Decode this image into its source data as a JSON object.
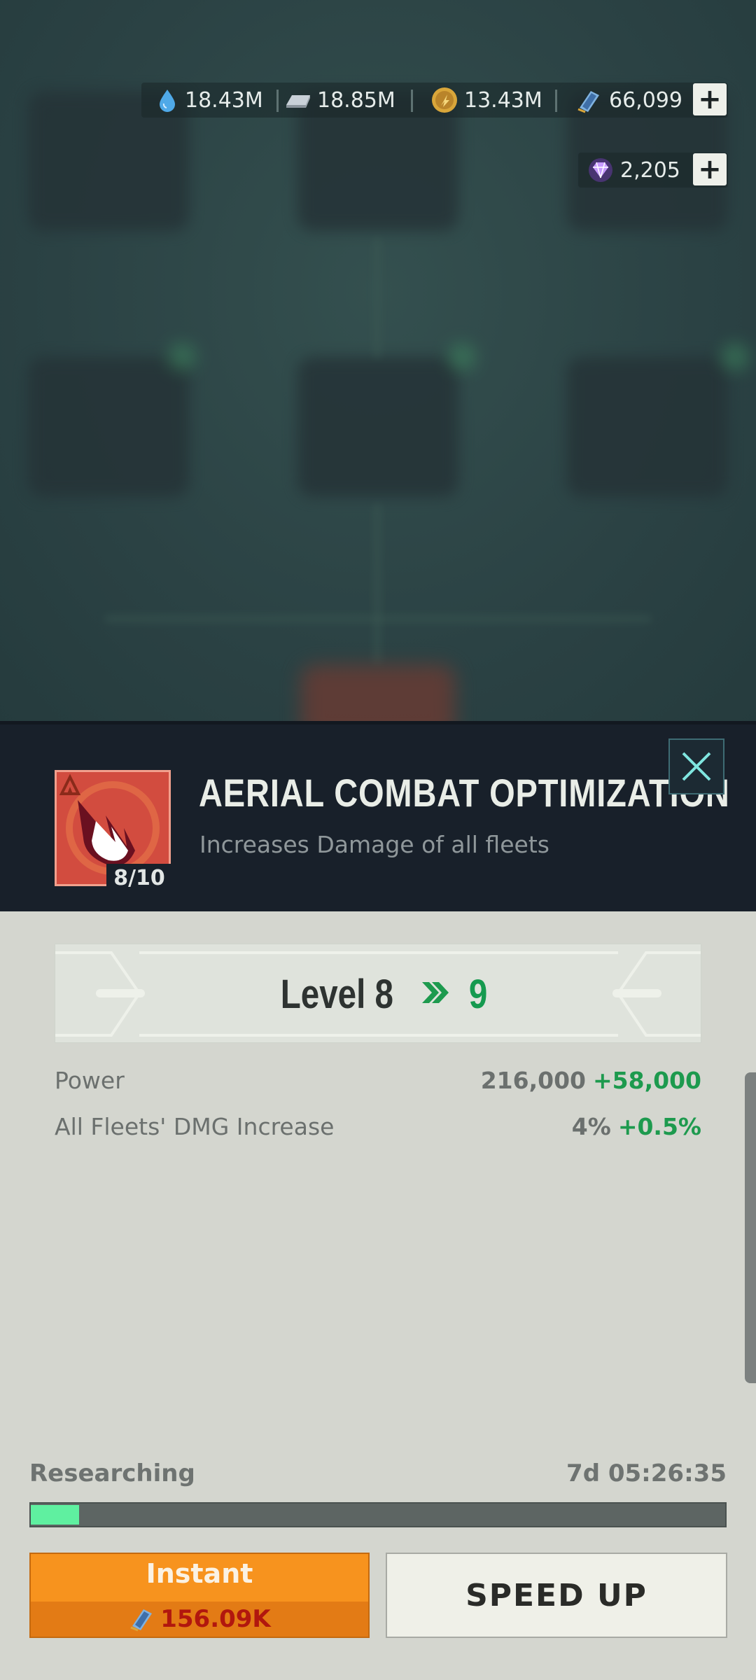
{
  "resources": {
    "water": "18.43M",
    "metal": "18.85M",
    "gold": "13.43M",
    "tickets": "66,099",
    "crystals": "2,205"
  },
  "research": {
    "title": "AERIAL COMBAT OPTIMIZATION",
    "description": "Increases Damage of all fleets",
    "level_badge": "8/10",
    "current_level_text": "Level 8",
    "next_level": "9",
    "stats": [
      {
        "label": "Power",
        "value": "216,000",
        "increase": "+58,000"
      },
      {
        "label": "All Fleets' DMG Increase",
        "value": "4%",
        "increase": "+0.5%"
      }
    ],
    "status_label": "Researching",
    "time_remaining": "7d 05:26:35",
    "progress_fraction": 0.07
  },
  "buttons": {
    "instant_label": "Instant",
    "instant_cost": "156.09K",
    "speed_up_label": "SPEED UP"
  },
  "colors": {
    "accent_orange": "#f7931e",
    "increase_green": "#1d9a4e",
    "progress_green": "#5ff0a0",
    "cost_red": "#b1170e"
  },
  "icons": [
    "water-drop-icon",
    "metal-ingot-icon",
    "gold-coin-icon",
    "ticket-icon",
    "crystal-icon",
    "plus-icon",
    "close-icon",
    "double-chevron-icon"
  ]
}
